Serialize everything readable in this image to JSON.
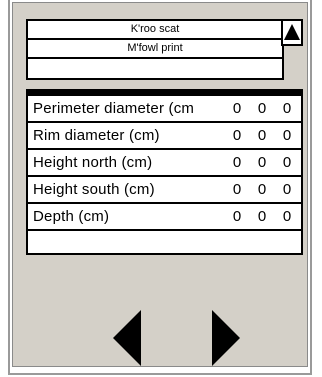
{
  "list": {
    "items": [
      "K'roo scat",
      "M'fowl print",
      ""
    ]
  },
  "icons": {
    "scroll_up": "triangle-up-icon",
    "prev": "triangle-left-icon",
    "next": "triangle-right-icon"
  },
  "table": {
    "rows": [
      {
        "label": "Perimeter diameter (cm",
        "values": [
          "0",
          "0",
          "0"
        ]
      },
      {
        "label": "Rim diameter (cm)",
        "values": [
          "0",
          "0",
          "0"
        ]
      },
      {
        "label": "Height north (cm)",
        "values": [
          "0",
          "0",
          "0"
        ]
      },
      {
        "label": "Height south (cm)",
        "values": [
          "0",
          "0",
          "0"
        ]
      },
      {
        "label": "Depth (cm)",
        "values": [
          "0",
          "0",
          "0"
        ]
      }
    ]
  }
}
